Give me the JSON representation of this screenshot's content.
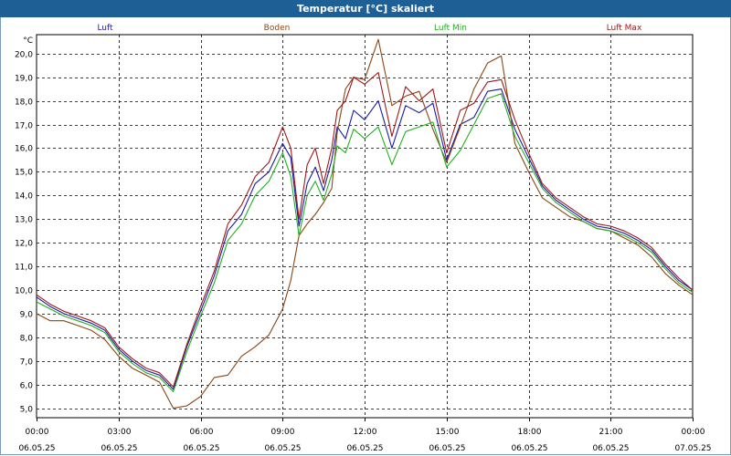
{
  "title": "Temperatur [°C] skaliert",
  "chart_data": {
    "type": "line",
    "title": "Temperatur [°C] skaliert",
    "ylabel": "°C",
    "ylim": [
      4.6,
      20.8
    ],
    "yticks": [
      "5,0",
      "6,0",
      "7,0",
      "8,0",
      "9,0",
      "10,0",
      "11,0",
      "12,0",
      "13,0",
      "14,0",
      "15,0",
      "16,0",
      "17,0",
      "18,0",
      "19,0",
      "20,0"
    ],
    "xticks": [
      {
        "time": "00:00",
        "date": "06.05.25"
      },
      {
        "time": "03:00",
        "date": "06.05.25"
      },
      {
        "time": "06:00",
        "date": "06.05.25"
      },
      {
        "time": "09:00",
        "date": "06.05.25"
      },
      {
        "time": "12:00",
        "date": "06.05.25"
      },
      {
        "time": "15:00",
        "date": "06.05.25"
      },
      {
        "time": "18:00",
        "date": "06.05.25"
      },
      {
        "time": "21:00",
        "date": "06.05.25"
      },
      {
        "time": "00:00",
        "date": "07.05.25"
      }
    ],
    "grid": true,
    "legend_position": "top",
    "series": [
      {
        "name": "Luft",
        "color": "#1a1aa8",
        "x": [
          0,
          0.5,
          1,
          1.5,
          2,
          2.5,
          3,
          3.5,
          4,
          4.5,
          5,
          5.5,
          6,
          6.5,
          7,
          7.5,
          8,
          8.5,
          9,
          9.3,
          9.6,
          9.9,
          10.2,
          10.5,
          10.8,
          11,
          11.3,
          11.6,
          12,
          12.5,
          13,
          13.5,
          14,
          14.5,
          15,
          15.5,
          16,
          16.5,
          17,
          17.5,
          18,
          18.5,
          19,
          19.5,
          20,
          20.5,
          21,
          21.5,
          22,
          22.5,
          23,
          23.5,
          24
        ],
        "values": [
          9.7,
          9.3,
          9.0,
          8.8,
          8.6,
          8.3,
          7.5,
          7.0,
          6.6,
          6.4,
          5.8,
          7.6,
          9.1,
          10.6,
          12.5,
          13.2,
          14.5,
          15.0,
          16.2,
          15.6,
          12.7,
          14.5,
          15.2,
          14.2,
          15.5,
          16.9,
          16.4,
          17.6,
          17.2,
          18.0,
          16.0,
          17.8,
          17.5,
          17.9,
          15.5,
          17.0,
          17.3,
          18.4,
          18.5,
          16.8,
          15.6,
          14.4,
          13.8,
          13.4,
          13.0,
          12.7,
          12.6,
          12.4,
          12.1,
          11.7,
          11.0,
          10.4,
          10.0
        ]
      },
      {
        "name": "Boden",
        "color": "#8b4513",
        "x": [
          0,
          0.5,
          1,
          1.5,
          2,
          2.5,
          3,
          3.5,
          4,
          4.5,
          5,
          5.5,
          6,
          6.5,
          7,
          7.5,
          8,
          8.5,
          9,
          9.3,
          9.6,
          9.9,
          10.2,
          10.5,
          10.8,
          11,
          11.3,
          11.6,
          12,
          12.5,
          13,
          13.5,
          14,
          14.5,
          15,
          15.5,
          16,
          16.5,
          17,
          17.5,
          18,
          18.5,
          19,
          19.5,
          20,
          20.5,
          21,
          21.5,
          22,
          22.5,
          23,
          23.5,
          24
        ],
        "values": [
          9.0,
          8.7,
          8.7,
          8.5,
          8.3,
          7.9,
          7.2,
          6.7,
          6.4,
          6.1,
          5.0,
          5.1,
          5.5,
          6.3,
          6.4,
          7.2,
          7.6,
          8.1,
          9.2,
          10.4,
          12.3,
          12.8,
          13.2,
          13.7,
          14.3,
          16.7,
          18.5,
          19.0,
          18.9,
          20.6,
          17.8,
          18.2,
          18.4,
          16.8,
          15.4,
          16.9,
          18.5,
          19.6,
          19.9,
          16.2,
          15.0,
          13.9,
          13.5,
          13.1,
          12.9,
          12.6,
          12.5,
          12.2,
          11.9,
          11.4,
          10.7,
          10.2,
          9.8
        ]
      },
      {
        "name": "Luft Min",
        "color": "#22b022",
        "x": [
          0,
          0.5,
          1,
          1.5,
          2,
          2.5,
          3,
          3.5,
          4,
          4.5,
          5,
          5.5,
          6,
          6.5,
          7,
          7.5,
          8,
          8.5,
          9,
          9.3,
          9.6,
          9.9,
          10.2,
          10.5,
          10.8,
          11,
          11.3,
          11.6,
          12,
          12.5,
          13,
          13.5,
          14,
          14.5,
          15,
          15.5,
          16,
          16.5,
          17,
          17.5,
          18,
          18.5,
          19,
          19.5,
          20,
          20.5,
          21,
          21.5,
          22,
          22.5,
          23,
          23.5,
          24
        ],
        "values": [
          9.5,
          9.2,
          8.9,
          8.7,
          8.5,
          8.2,
          7.4,
          6.9,
          6.5,
          6.3,
          5.7,
          7.4,
          8.9,
          10.3,
          12.1,
          12.8,
          14.0,
          14.6,
          15.8,
          14.8,
          12.3,
          14.0,
          14.6,
          13.8,
          14.9,
          16.1,
          15.8,
          16.8,
          16.4,
          16.9,
          15.3,
          16.7,
          16.9,
          17.1,
          15.2,
          15.9,
          17.0,
          18.1,
          18.3,
          16.5,
          15.4,
          14.3,
          13.7,
          13.3,
          12.9,
          12.6,
          12.5,
          12.3,
          12.0,
          11.6,
          10.9,
          10.3,
          9.9
        ]
      },
      {
        "name": "Luft Max",
        "color": "#a01818",
        "x": [
          0,
          0.5,
          1,
          1.5,
          2,
          2.5,
          3,
          3.5,
          4,
          4.5,
          5,
          5.5,
          6,
          6.5,
          7,
          7.5,
          8,
          8.5,
          9,
          9.3,
          9.6,
          9.9,
          10.2,
          10.5,
          10.8,
          11,
          11.3,
          11.6,
          12,
          12.5,
          13,
          13.5,
          14,
          14.5,
          15,
          15.5,
          16,
          16.5,
          17,
          17.5,
          18,
          18.5,
          19,
          19.5,
          20,
          20.5,
          21,
          21.5,
          22,
          22.5,
          23,
          23.5,
          24
        ],
        "values": [
          9.8,
          9.4,
          9.1,
          8.9,
          8.7,
          8.4,
          7.6,
          7.1,
          6.7,
          6.5,
          5.9,
          7.7,
          9.3,
          10.8,
          12.8,
          13.6,
          14.8,
          15.4,
          16.9,
          16.0,
          13.0,
          15.3,
          16.0,
          14.5,
          16.0,
          17.6,
          18.0,
          19.0,
          18.7,
          19.2,
          16.5,
          18.6,
          18.0,
          18.5,
          15.8,
          17.6,
          17.9,
          18.8,
          18.9,
          17.2,
          15.8,
          14.5,
          13.9,
          13.5,
          13.1,
          12.8,
          12.7,
          12.5,
          12.2,
          11.8,
          11.1,
          10.5,
          10.0
        ]
      }
    ]
  }
}
